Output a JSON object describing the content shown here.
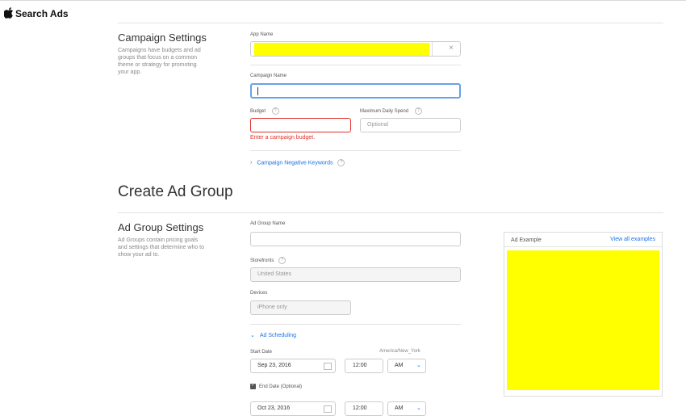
{
  "header": {
    "brand": "Search Ads"
  },
  "campaign": {
    "title": "Campaign Settings",
    "desc": "Campaigns have budgets and ad groups that focus on a common theme or strategy for promoting your app.",
    "app_name_label": "App Name",
    "campaign_name_label": "Campaign Name",
    "campaign_name_value": "",
    "budget_label": "Budget",
    "budget_value": "",
    "budget_error": "Enter a campaign budget.",
    "max_spend_label": "Maximum Daily Spend",
    "max_spend_placeholder": "Optional",
    "negative_keywords": "Campaign Negative Keywords"
  },
  "adgroup": {
    "heading": "Create Ad Group",
    "title": "Ad Group Settings",
    "desc": "Ad Groups contain pricing goals and settings that determine who to show your ad to.",
    "name_label": "Ad Group Name",
    "name_value": "",
    "storefronts_label": "Storefronts",
    "storefronts_value": "United States",
    "devices_label": "Devices",
    "devices_value": "iPhone only",
    "scheduling": "Ad Scheduling",
    "start_label": "Start Date",
    "timezone": "America/New_York",
    "start_date": "Sep 23, 2016",
    "start_time": "12:00",
    "start_ampm": "AM",
    "end_label": "End Date (Optional)",
    "end_date": "Oct 23, 2016",
    "end_time": "12:00",
    "end_ampm": "AM"
  },
  "ad_example": {
    "title": "Ad Example",
    "view_all": "View all examples"
  },
  "colors": {
    "accent": "#1a73e8",
    "error": "#e0322b",
    "redaction": "#ffff00",
    "focus": "#6aa1e8"
  }
}
